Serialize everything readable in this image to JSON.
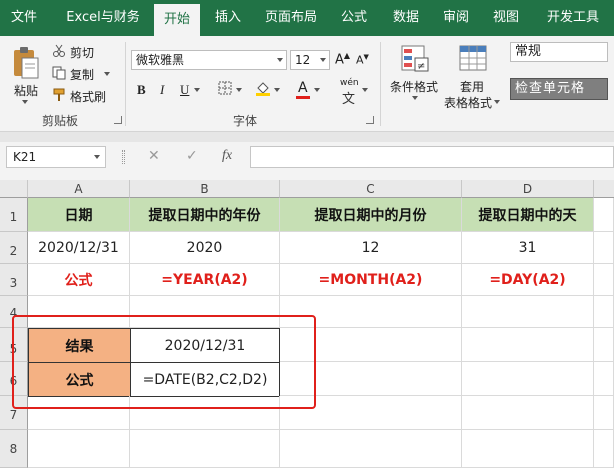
{
  "tabs": [
    {
      "label": "文件"
    },
    {
      "label": "Excel与财务"
    },
    {
      "label": "开始"
    },
    {
      "label": "插入"
    },
    {
      "label": "页面布局"
    },
    {
      "label": "公式"
    },
    {
      "label": "数据"
    },
    {
      "label": "审阅"
    },
    {
      "label": "视图"
    },
    {
      "label": "开发工具"
    }
  ],
  "ribbon": {
    "clipboard": {
      "paste": "粘贴",
      "cut": "剪切",
      "copy": "复制",
      "format_painter": "格式刷",
      "group_label": "剪贴板"
    },
    "font": {
      "font_name": "微软雅黑",
      "font_size": "12",
      "grow": "A",
      "shrink": "A",
      "bold": "B",
      "italic": "I",
      "underline": "U",
      "font_color_letter": "A",
      "phonetic": "wén",
      "group_label": "字体"
    },
    "styles": {
      "conditional_format": "条件格式",
      "table_format_line1": "套用",
      "table_format_line2": "表格格式",
      "normal": "常规",
      "check_cell": "检查单元格"
    }
  },
  "formula_bar": {
    "name_box": "K21",
    "cancel": "✕",
    "enter": "✓",
    "fx": "fx",
    "content": ""
  },
  "sheet": {
    "columns": [
      "A",
      "B",
      "C",
      "D"
    ],
    "rows": [
      "1",
      "2",
      "3",
      "4",
      "5",
      "6",
      "7",
      "8"
    ],
    "r1": [
      "日期",
      "提取日期中的年份",
      "提取日期中的月份",
      "提取日期中的天"
    ],
    "r2": [
      "2020/12/31",
      "2020",
      "12",
      "31"
    ],
    "r3": [
      "公式",
      "=YEAR(A2)",
      "=MONTH(A2)",
      "=DAY(A2)"
    ],
    "r5": [
      "结果",
      "2020/12/31"
    ],
    "r6": [
      "公式",
      "=DATE(B2,C2,D2)"
    ]
  },
  "colors": {
    "ribbon_green": "#217346",
    "header_fill": "#c6dfb4",
    "label_fill": "#f4b183",
    "formula_red": "#e0201b"
  }
}
